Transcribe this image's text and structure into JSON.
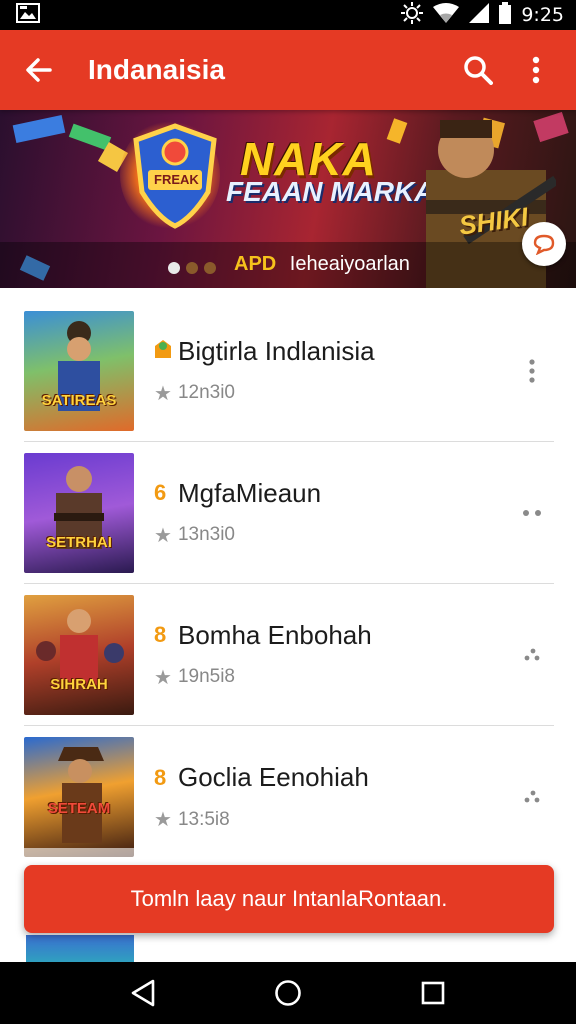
{
  "status_bar": {
    "time": "9:25"
  },
  "app_bar": {
    "title": "Indanaisia"
  },
  "banner": {
    "logo_main": "NAKA",
    "logo_sub": "FEAAN MARKAN",
    "badge_text": "FREAK",
    "hero_text": "SHIKI",
    "caption_tag": "APD",
    "caption": "Ieheaiyoarlan"
  },
  "items": [
    {
      "name": "Bigtirla Indlanisia",
      "rating": "12n3i0",
      "badge": "●",
      "thumb_text": "SATIREAS"
    },
    {
      "name": "MgfaMieaun",
      "rating": "13n3i0",
      "badge": "6",
      "thumb_text": "SETRHAI"
    },
    {
      "name": "Bomha Enbohah",
      "rating": "19n5i8",
      "badge": "8",
      "thumb_text": "SIHRAH"
    },
    {
      "name": "Goclia Eenohiah",
      "rating": "13:5i8",
      "badge": "8",
      "thumb_text": "SETEAM"
    }
  ],
  "toast": {
    "text": "Tomln laay naur IntanlaRontaan."
  },
  "colors": {
    "primary": "#e53a24",
    "accent": "#f29a12"
  }
}
